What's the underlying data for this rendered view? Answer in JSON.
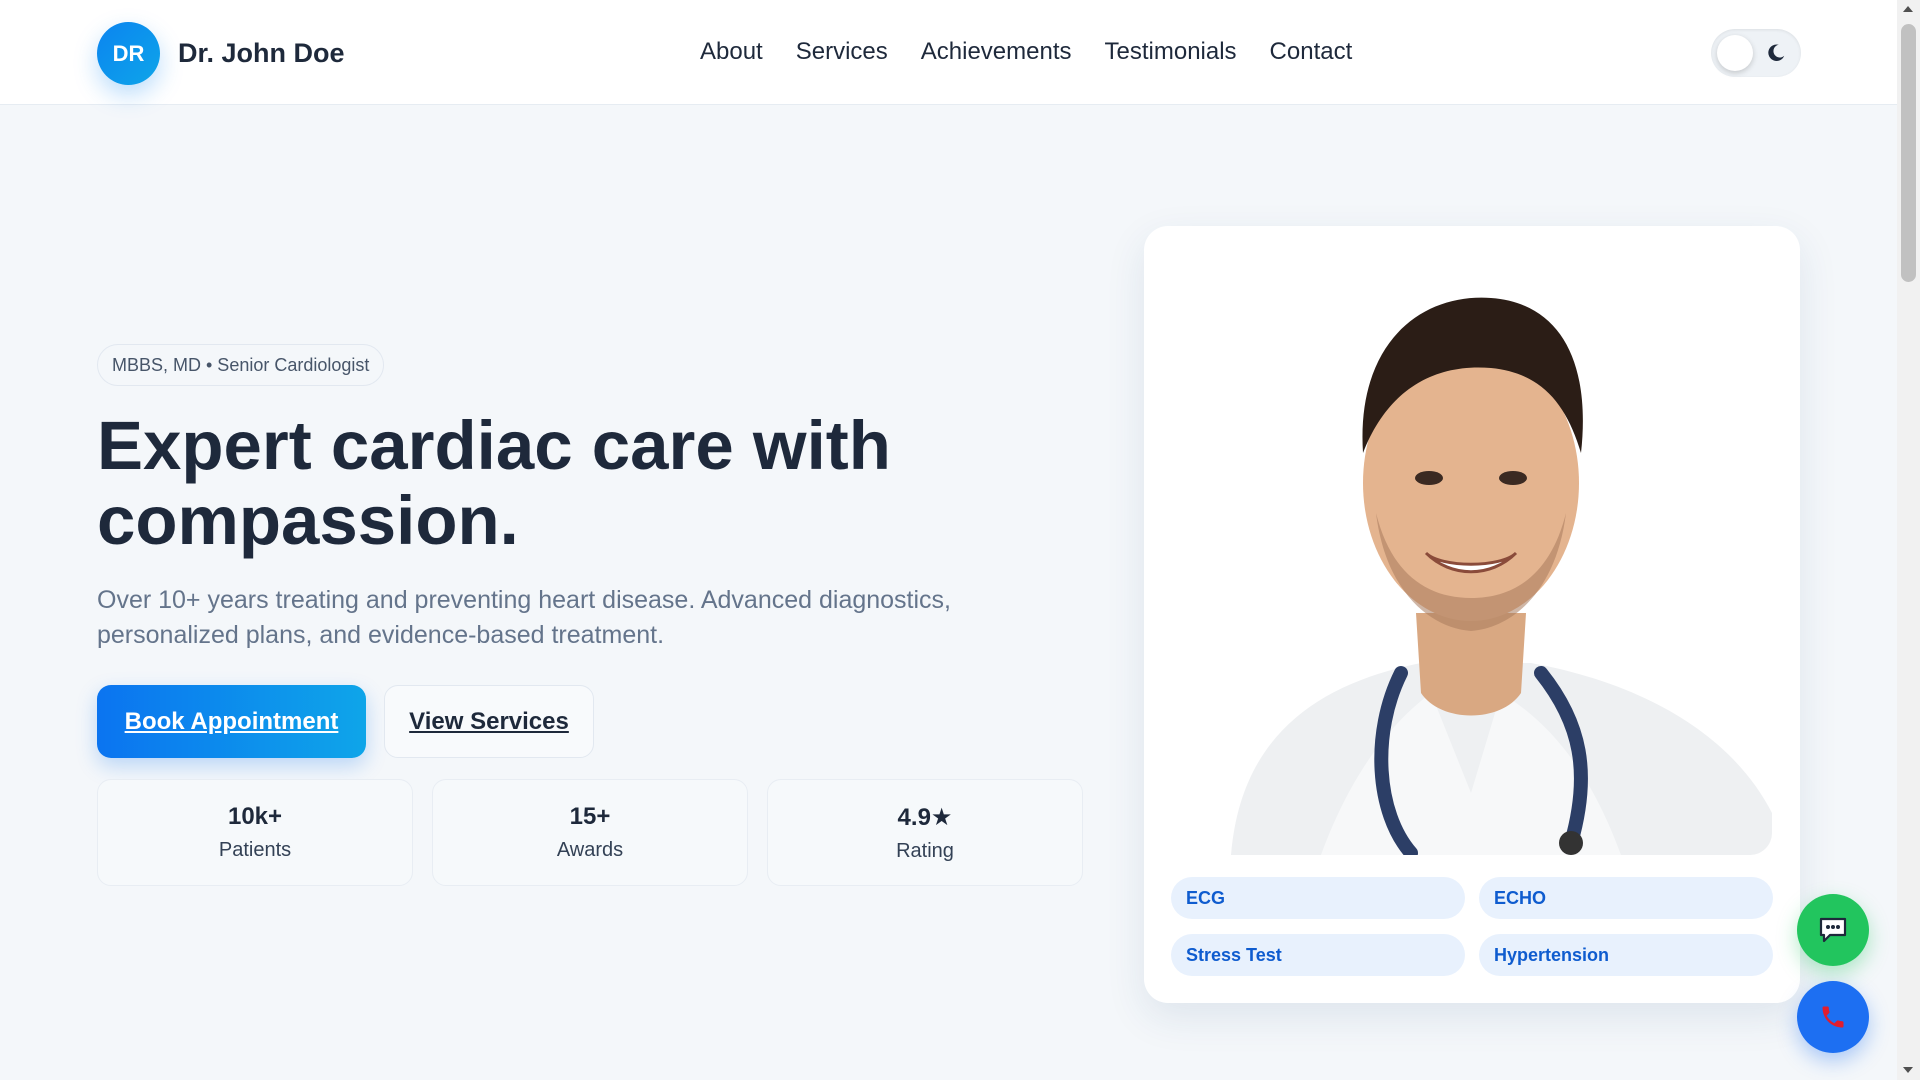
{
  "header": {
    "logo_initials": "DR",
    "brand_name": "Dr. John Doe",
    "nav": [
      "About",
      "Services",
      "Achievements",
      "Testimonials",
      "Contact"
    ],
    "theme_toggle_icon": "moon-icon"
  },
  "hero": {
    "credentials": "MBBS, MD • Senior Cardiologist",
    "title": "Expert cardiac care with compassion.",
    "subtitle": "Over 10+ years treating and preventing heart disease. Advanced diagnostics, personalized plans, and evidence-based treatment.",
    "primary_cta": "Book Appointment",
    "secondary_cta": "View Services",
    "stats": [
      {
        "value": "10k+",
        "label": "Patients"
      },
      {
        "value": "15+",
        "label": "Awards"
      },
      {
        "value": "4.9★",
        "label": "Rating"
      }
    ]
  },
  "card": {
    "tags": [
      "ECG",
      "ECHO",
      "Stress Test",
      "Hypertension"
    ]
  },
  "floating": {
    "chat_icon": "chat-icon",
    "call_icon": "phone-icon"
  },
  "colors": {
    "accent": "#0b74f0",
    "accent_light": "#0ea5e9",
    "tag_bg": "#e8f1fd",
    "tag_text": "#0f5ccf",
    "chat_fab": "#22c55e",
    "call_fab": "#1d6ff2",
    "page_bg": "#f4f7fa"
  }
}
